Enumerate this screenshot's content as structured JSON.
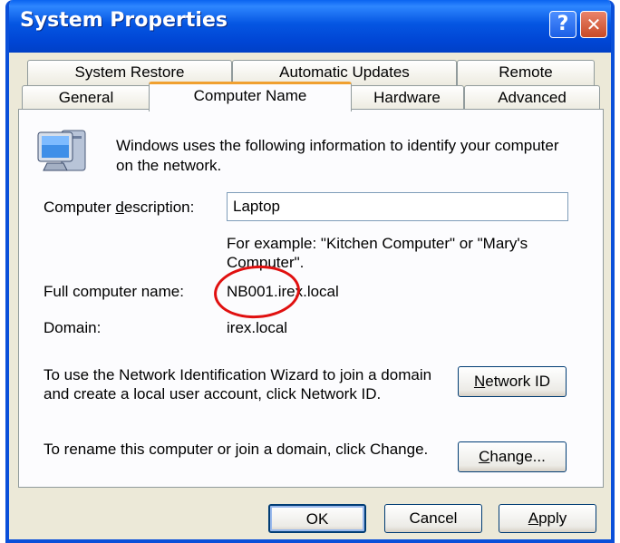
{
  "window": {
    "title": "System Properties",
    "help_label": "?",
    "close_label": "✕",
    "accent": "#0A4FD9"
  },
  "tabs": {
    "row1": [
      "System Restore",
      "Automatic Updates",
      "Remote"
    ],
    "row2": [
      "General",
      "Computer Name",
      "Hardware",
      "Advanced"
    ],
    "active": "Computer Name"
  },
  "content": {
    "intro": "Windows uses the following information to identify your computer on the network.",
    "description_label_pre": "Computer ",
    "description_label_access": "d",
    "description_label_post": "escription:",
    "description_value": "Laptop",
    "example_text": "For example: \"Kitchen Computer\" or \"Mary's Computer\".",
    "full_name_label": "Full computer name:",
    "full_name_value": "NB001.irex.local",
    "domain_label": "Domain:",
    "domain_value": "irex.local",
    "network_id_text": "To use the Network Identification Wizard to join a domain and create a local user account, click Network ID.",
    "network_id_button_access": "N",
    "network_id_button_rest": "etwork ID",
    "rename_text": "To rename this computer or join a domain, click Change.",
    "change_button_access": "C",
    "change_button_rest": "hange..."
  },
  "footer": {
    "ok_label": "OK",
    "cancel_label": "Cancel",
    "apply_access": "A",
    "apply_rest": "pply"
  },
  "annotation_color": "#E01010"
}
